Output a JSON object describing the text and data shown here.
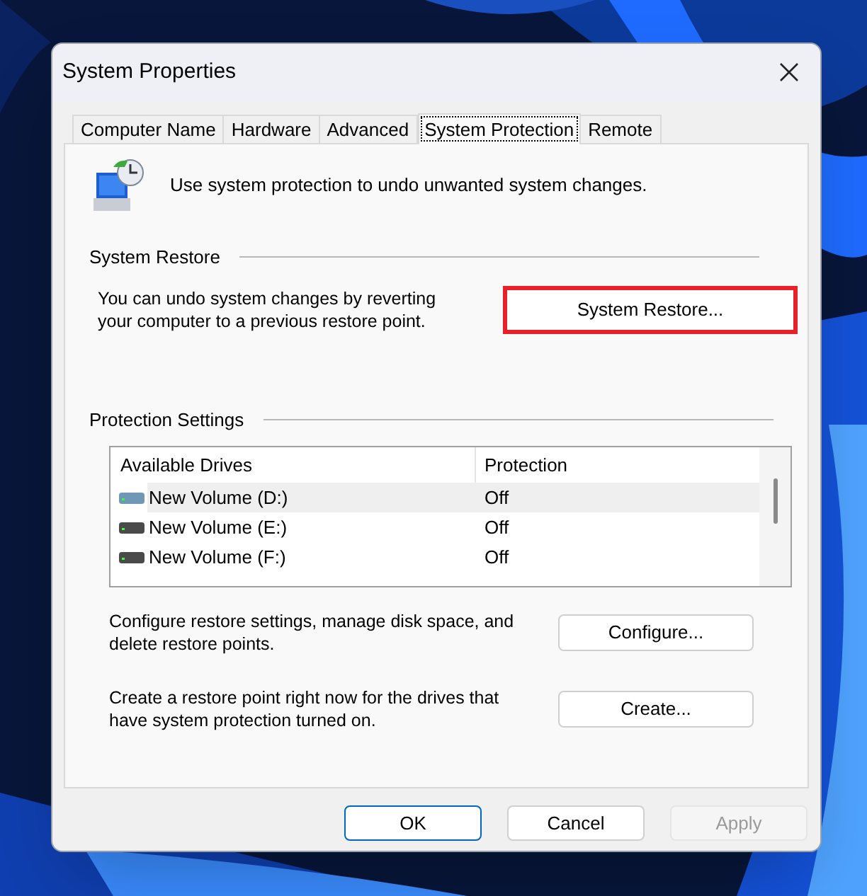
{
  "window": {
    "title": "System Properties"
  },
  "tabs": [
    {
      "label": "Computer Name",
      "selected": false
    },
    {
      "label": "Hardware",
      "selected": false
    },
    {
      "label": "Advanced",
      "selected": false
    },
    {
      "label": "System Protection",
      "selected": true
    },
    {
      "label": "Remote",
      "selected": false
    }
  ],
  "intro": "Use system protection to undo unwanted system changes.",
  "system_restore": {
    "title": "System Restore",
    "description": "You can undo system changes by reverting your computer to a previous restore point.",
    "button": {
      "label": "System Restore...",
      "highlighted": true
    }
  },
  "protection_settings": {
    "title": "Protection Settings",
    "columns": [
      "Available Drives",
      "Protection"
    ],
    "drives": [
      {
        "name": "New Volume (D:)",
        "protection": "Off",
        "selected": true,
        "color": "#6f98b4"
      },
      {
        "name": "New Volume (E:)",
        "protection": "Off",
        "selected": false,
        "color": "#4a4a4a"
      },
      {
        "name": "New Volume (F:)",
        "protection": "Off",
        "selected": false,
        "color": "#4a4a4a"
      }
    ],
    "actions": [
      {
        "description": "Configure restore settings, manage disk space, and delete restore points.",
        "button": "Configure..."
      },
      {
        "description": "Create a restore point right now for the drives that have system protection turned on.",
        "button": "Create..."
      }
    ]
  },
  "buttons": [
    {
      "label": "OK",
      "default": true,
      "disabled": false
    },
    {
      "label": "Cancel",
      "default": false,
      "disabled": false
    },
    {
      "label": "Apply",
      "default": false,
      "disabled": true
    }
  ]
}
